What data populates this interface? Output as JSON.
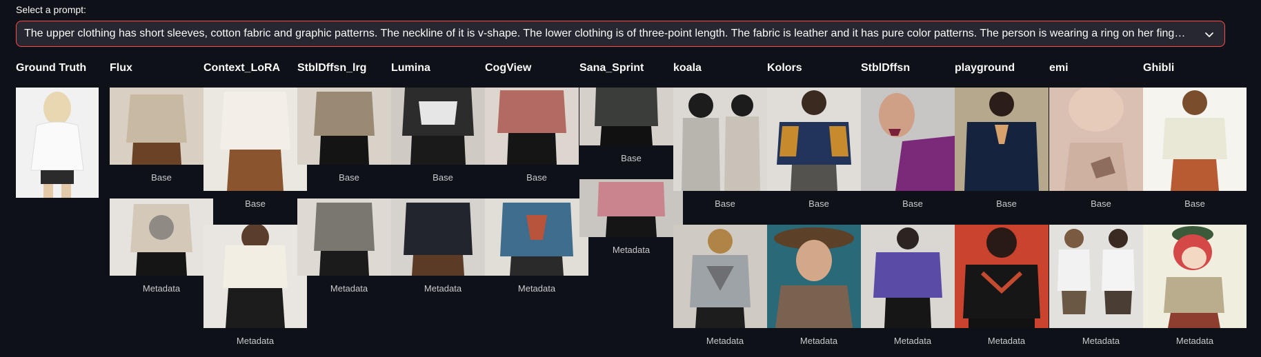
{
  "prompt": {
    "label": "Select a prompt:",
    "selected": "The upper clothing has short sleeves, cotton fabric and graphic patterns. The neckline of it is v-shape. The lower clothing is of three-point length. The fabric is leather and it has pure color patterns. The person is wearing a ring on her finger. There is an acc…"
  },
  "colors": {
    "background": "#0e1117",
    "select_border": "#ff4b4b",
    "select_fill": "#262730"
  },
  "columns": [
    {
      "name": "Ground Truth"
    },
    {
      "name": "Flux",
      "base": "Base",
      "meta": "Metadata"
    },
    {
      "name": "Context_LoRA",
      "base": "Base",
      "meta": "Metadata"
    },
    {
      "name": "StblDffsn_lrg",
      "base": "Base",
      "meta": "Metadata"
    },
    {
      "name": "Lumina",
      "base": "Base",
      "meta": "Metadata"
    },
    {
      "name": "CogView",
      "base": "Base",
      "meta": "Metadata"
    },
    {
      "name": "Sana_Sprint",
      "base": "Base",
      "meta": "Metadata"
    },
    {
      "name": "koala",
      "base": "Base",
      "meta": "Metadata"
    },
    {
      "name": "Kolors",
      "base": "Base",
      "meta": "Metadata"
    },
    {
      "name": "StblDffsn",
      "base": "Base",
      "meta": "Metadata"
    },
    {
      "name": "playground",
      "base": "Base",
      "meta": "Metadata"
    },
    {
      "name": "emi",
      "base": "Base",
      "meta": "Metadata"
    },
    {
      "name": "Ghibli",
      "base": "Base",
      "meta": "Metadata"
    }
  ],
  "icons": {
    "dropdown": "chevron-down-icon"
  }
}
